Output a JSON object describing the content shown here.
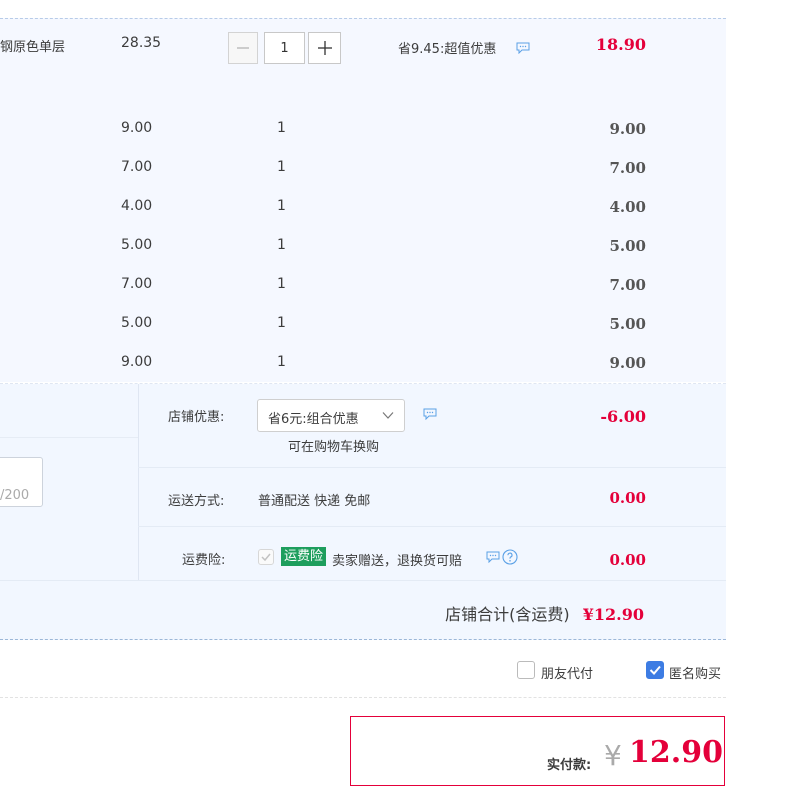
{
  "main_item": {
    "name": "钢原色单层",
    "unit_price": "28.35",
    "quantity": "1",
    "promotion": "省9.45:超值优惠",
    "subtotal": "18.90"
  },
  "sub_items": [
    {
      "price": "9.00",
      "quantity": "1",
      "subtotal": "9.00"
    },
    {
      "price": "7.00",
      "quantity": "1",
      "subtotal": "7.00"
    },
    {
      "price": "4.00",
      "quantity": "1",
      "subtotal": "4.00"
    },
    {
      "price": "5.00",
      "quantity": "1",
      "subtotal": "5.00"
    },
    {
      "price": "7.00",
      "quantity": "1",
      "subtotal": "7.00"
    },
    {
      "price": "5.00",
      "quantity": "1",
      "subtotal": "5.00"
    },
    {
      "price": "9.00",
      "quantity": "1",
      "subtotal": "9.00"
    }
  ],
  "shop": {
    "discount_label": "店铺优惠:",
    "discount_select": "省6元:组合优惠",
    "discount_hint": "可在购物车换购",
    "discount_value": "-6.00",
    "shipping_label": "运送方式:",
    "shipping_method": "普通配送 快递 免邮",
    "shipping_value": "0.00",
    "insurance_label": "运费险:",
    "insurance_tag": "运费险",
    "insurance_text": "卖家赠送，退换货可赔",
    "insurance_value": "0.00",
    "memo_counter": "/200",
    "total_label": "店铺合计(含运费)",
    "total_value": "¥12.90"
  },
  "options": {
    "friend_pay_label": "朋友代付",
    "friend_pay_checked": false,
    "anonymous_label": "匿名购买",
    "anonymous_checked": true
  },
  "payment": {
    "label": "实付款:",
    "currency": "¥",
    "amount": "12.90"
  },
  "colors": {
    "price_red": "#e4003a",
    "accent_blue": "#3d7ce3",
    "tag_green": "#1e9e5d"
  },
  "icons": [
    "minus-icon",
    "plus-icon",
    "chat-icon",
    "chevron-down-icon",
    "check-icon",
    "help-icon"
  ]
}
